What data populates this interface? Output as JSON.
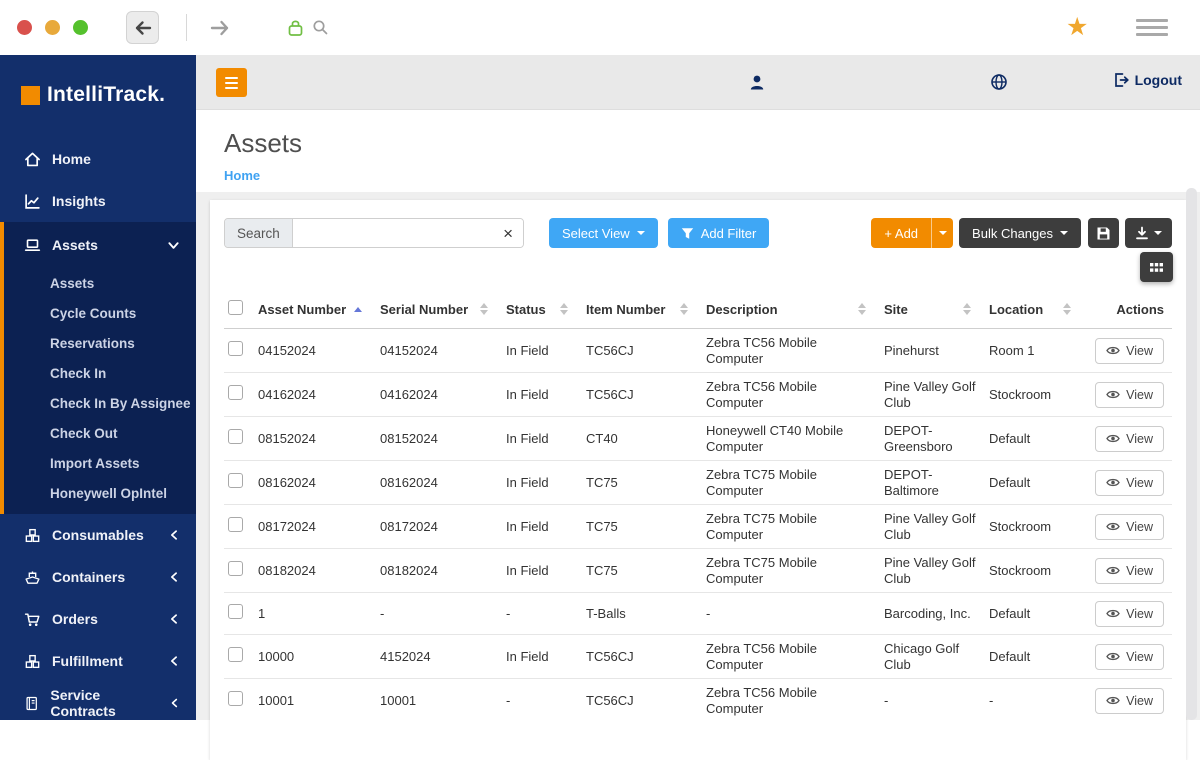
{
  "browser": {
    "star_glyph": "★"
  },
  "sidebar": {
    "logo": "IntelliTrack.",
    "items": {
      "home": "Home",
      "insights": "Insights",
      "assets": "Assets",
      "consumables": "Consumables",
      "containers": "Containers",
      "orders": "Orders",
      "fulfillment": "Fulfillment",
      "service_contracts": "Service Contracts"
    },
    "assets_subitems": [
      {
        "label": "Assets"
      },
      {
        "label": "Cycle Counts"
      },
      {
        "label": "Reservations"
      },
      {
        "label": "Check In"
      },
      {
        "label": "Check In By Assignee"
      },
      {
        "label": "Check Out"
      },
      {
        "label": "Import Assets"
      },
      {
        "label": "Honeywell OpIntel"
      }
    ]
  },
  "topbar": {
    "logout": "Logout"
  },
  "page": {
    "title": "Assets",
    "breadcrumb_home": "Home"
  },
  "toolbar": {
    "search_label": "Search",
    "clear_glyph": "×",
    "select_view": "Select View",
    "add_filter": "Add Filter",
    "add": "+ Add",
    "bulk_changes": "Bulk Changes"
  },
  "table": {
    "view_label": "View",
    "headers": [
      "Asset Number",
      "Serial Number",
      "Status",
      "Item Number",
      "Description",
      "Site",
      "Location",
      "Actions"
    ],
    "rows": [
      {
        "asset": "04152024",
        "serial": "04152024",
        "status": "In Field",
        "item": "TC56CJ",
        "description": "Zebra TC56 Mobile Computer",
        "site": "Pinehurst",
        "location": "Room 1",
        "blocked": false,
        "checked": false
      },
      {
        "asset": "04162024",
        "serial": "04162024",
        "status": "In Field",
        "item": "TC56CJ",
        "description": "Zebra TC56 Mobile Computer",
        "site": "Pine Valley Golf Club",
        "location": "Stockroom",
        "blocked": false,
        "checked": false
      },
      {
        "asset": "08152024",
        "serial": "08152024",
        "status": "In Field",
        "item": "CT40",
        "description": "Honeywell CT40 Mobile Computer",
        "site": "DEPOT-Greensboro",
        "location": "Default",
        "blocked": false,
        "checked": false
      },
      {
        "asset": "08162024",
        "serial": "08162024",
        "status": "In Field",
        "item": "TC75",
        "description": "Zebra TC75 Mobile Computer",
        "site": "DEPOT-Baltimore",
        "location": "Default",
        "blocked": true,
        "checked": false
      },
      {
        "asset": "08172024",
        "serial": "08172024",
        "status": "In Field",
        "item": "TC75",
        "description": "Zebra TC75 Mobile Computer",
        "site": "Pine Valley Golf Club",
        "location": "Stockroom",
        "blocked": true,
        "checked": false
      },
      {
        "asset": "08182024",
        "serial": "08182024",
        "status": "In Field",
        "item": "TC75",
        "description": "Zebra TC75 Mobile Computer",
        "site": "Pine Valley Golf Club",
        "location": "Stockroom",
        "blocked": false,
        "checked": false
      },
      {
        "asset": "1",
        "serial": "-",
        "status": "-",
        "item": "T-Balls",
        "description": "-",
        "site": "Barcoding, Inc.",
        "location": "Default",
        "blocked": false,
        "checked": false
      },
      {
        "asset": "10000",
        "serial": "4152024",
        "status": "In Field",
        "item": "TC56CJ",
        "description": "Zebra TC56 Mobile Computer",
        "site": "Chicago Golf Club",
        "location": "Default",
        "blocked": false,
        "checked": true
      },
      {
        "asset": "10001",
        "serial": "10001",
        "status": "-",
        "item": "TC56CJ",
        "description": "Zebra TC56 Mobile Computer",
        "site": "-",
        "location": "-",
        "blocked": false,
        "checked": false
      }
    ]
  },
  "colors": {
    "sidebar_navy": "#132f6b",
    "sidebar_active": "#0c2152",
    "accent_orange": "#f28b00",
    "button_blue": "#3fa7f5",
    "button_dark": "#3d3d3d",
    "link_blue": "#3fa2f2",
    "danger_red": "#dc2440",
    "star_orange": "#f0a72e"
  }
}
